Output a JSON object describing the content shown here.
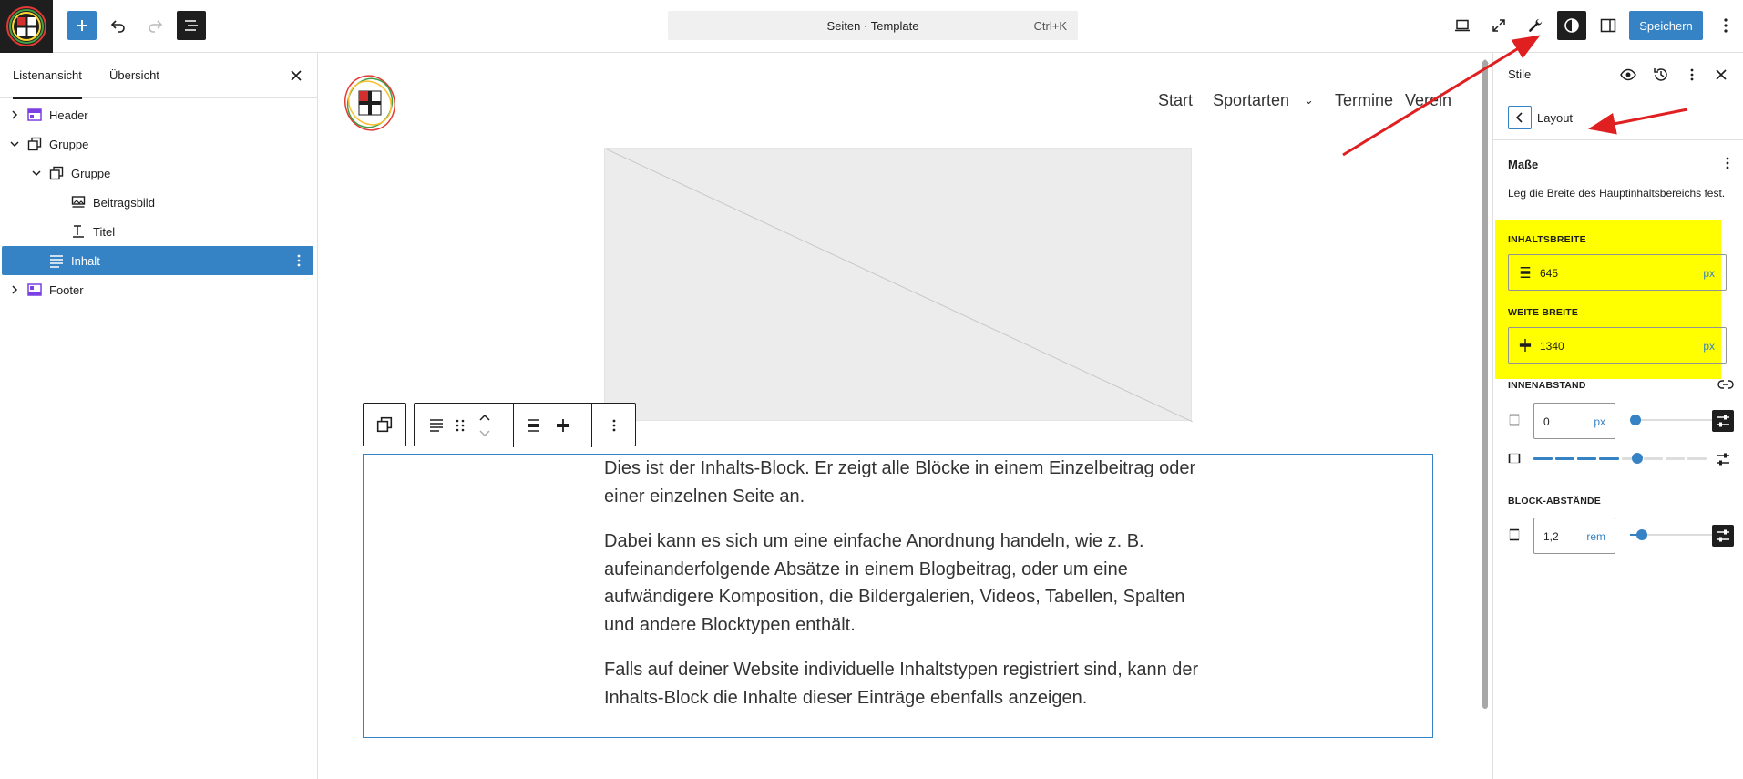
{
  "topbar": {
    "command_title": "Seiten · Template",
    "command_shortcut": "Ctrl+K",
    "save_label": "Speichern"
  },
  "left_panel": {
    "tabs": [
      {
        "label": "Listenansicht",
        "active": true
      },
      {
        "label": "Übersicht",
        "active": false
      }
    ],
    "tree": [
      {
        "label": "Header",
        "icon": "template-part-icon",
        "level": 0,
        "expandable": true,
        "expanded": false,
        "selected": false
      },
      {
        "label": "Gruppe",
        "icon": "group-icon",
        "level": 0,
        "expandable": true,
        "expanded": true,
        "selected": false
      },
      {
        "label": "Gruppe",
        "icon": "group-icon",
        "level": 1,
        "expandable": true,
        "expanded": true,
        "selected": false
      },
      {
        "label": "Beitragsbild",
        "icon": "featured-image-icon",
        "level": 2,
        "expandable": false,
        "selected": false
      },
      {
        "label": "Titel",
        "icon": "title-icon",
        "level": 2,
        "expandable": false,
        "selected": false
      },
      {
        "label": "Inhalt",
        "icon": "content-icon",
        "level": 2,
        "expandable": false,
        "selected": true
      },
      {
        "label": "Footer",
        "icon": "template-part-icon",
        "level": 0,
        "expandable": true,
        "expanded": false,
        "selected": false
      }
    ]
  },
  "canvas": {
    "nav": [
      "Start",
      "Sportarten",
      "Termine",
      "Verein"
    ],
    "content_paragraphs": [
      "Dies ist der Inhalts-Block. Er zeigt alle Blöcke in einem Einzelbeitrag oder einer einzelnen Seite an.",
      "Dabei kann es sich um eine einfache Anordnung handeln, wie z. B. aufeinanderfolgende Absätze in einem Blogbeitrag, oder um eine aufwändigere Komposition, die Bildergalerien, Videos, Tabellen, Spalten und andere Blocktypen enthält.",
      "Falls auf deiner Website individuelle Inhaltstypen registriert sind, kann der Inhalts-Block die Inhalte dieser Einträge ebenfalls anzeigen."
    ]
  },
  "right_panel": {
    "title": "Stile",
    "nav_title": "Layout",
    "section_title": "Maße",
    "section_desc": "Leg die Breite des Hauptinhaltsbereichs fest.",
    "content_width": {
      "label": "Inhaltsbreite",
      "value": "645",
      "unit": "px"
    },
    "wide_width": {
      "label": "Weite Breite",
      "value": "1340",
      "unit": "px"
    },
    "padding": {
      "label": "Innenabstand",
      "value": "0",
      "unit": "px",
      "slider_fraction": 0.0,
      "segment_fraction": 0.6
    },
    "block_spacing": {
      "label": "Block-Abstände",
      "value": "1,2",
      "unit": "rem",
      "slider_fraction": 0.08
    }
  },
  "colors": {
    "accent": "#3582c4",
    "dark": "#1e1e1e",
    "highlight": "#ffff00",
    "annotation_arrow": "#e02020"
  }
}
